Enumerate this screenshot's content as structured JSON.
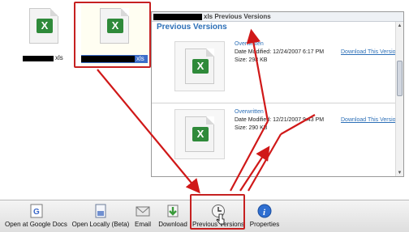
{
  "files": [
    {
      "name_visible": "xls"
    },
    {
      "name_visible": "xls"
    }
  ],
  "panel": {
    "title": "xls Previous Versions",
    "subtitle": "Previous Versions",
    "versions": [
      {
        "status": "Overwritten",
        "date": "Date Modified: 12/24/2007 6:17 PM",
        "size": "Size: 298 KB",
        "link": "Download This Version"
      },
      {
        "status": "Overwritten",
        "date": "Date Modified: 12/21/2007 9:43 PM",
        "size": "Size: 290 KB",
        "link": "Download This Version"
      }
    ]
  },
  "toolbar": {
    "items": [
      {
        "label": "Open at Google Docs",
        "icon": "google-docs-icon"
      },
      {
        "label": "Open Locally (Beta)",
        "icon": "document-icon"
      },
      {
        "label": "Email",
        "icon": "email-icon"
      },
      {
        "label": "Download",
        "icon": "download-icon"
      },
      {
        "label": "Previous Versions",
        "icon": "clock-icon"
      },
      {
        "label": "Properties",
        "icon": "info-icon"
      }
    ]
  },
  "colors": {
    "accent": "#2c6fb7",
    "highlight": "#c62020",
    "excel_green": "#2f8a3a"
  }
}
